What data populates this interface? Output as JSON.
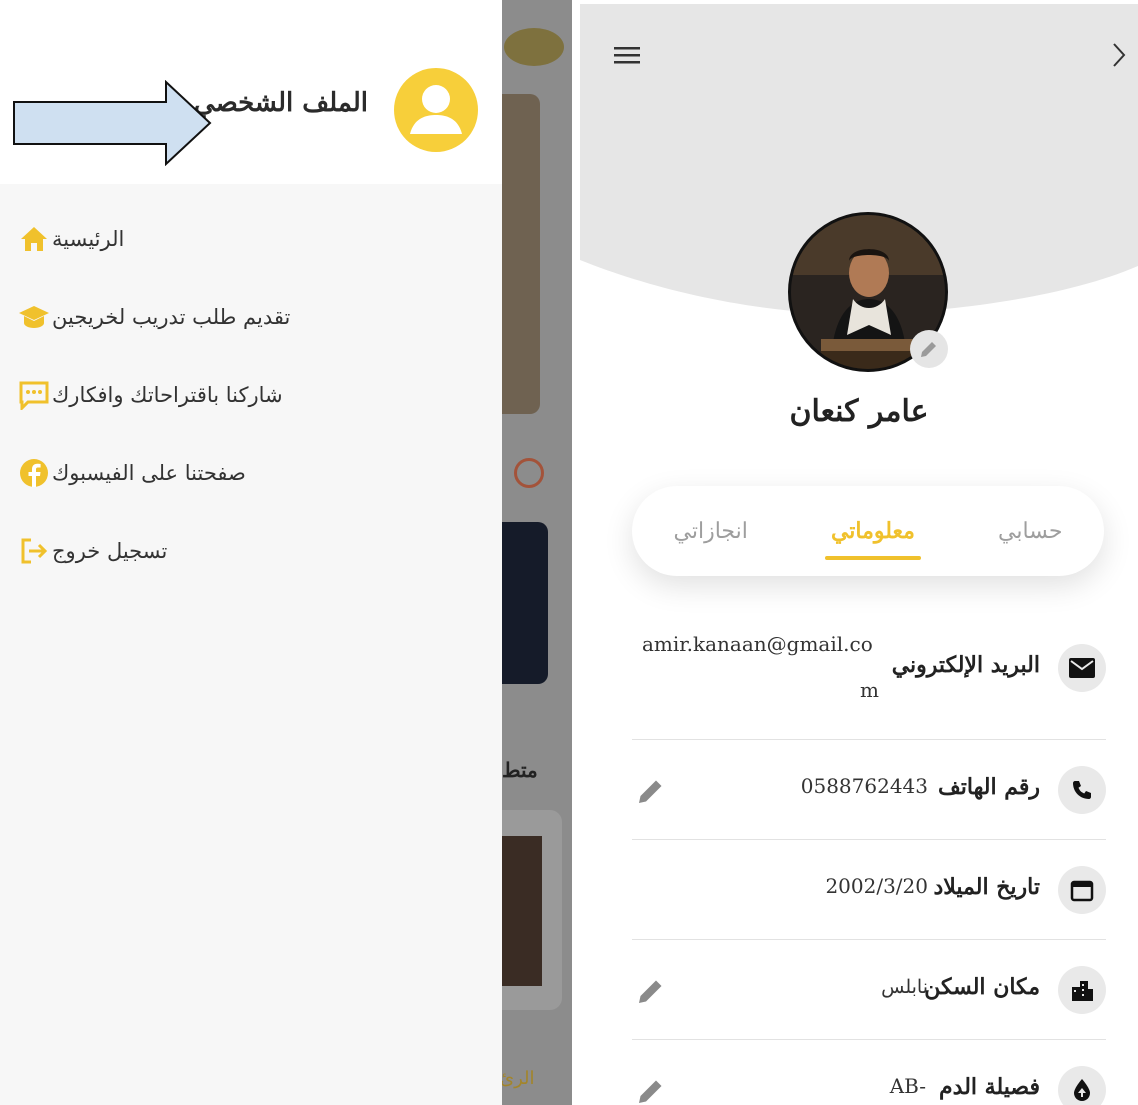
{
  "drawer": {
    "title": "الملف الشخصي",
    "items": [
      {
        "label": "الرئيسية",
        "icon": "home-icon"
      },
      {
        "label": "تقديم طلب تدريب لخريجين",
        "icon": "graduation-cap-icon"
      },
      {
        "label": "شاركنا باقتراحاتك وافكارك",
        "icon": "comment-icon"
      },
      {
        "label": "صفحتنا على الفيسبوك",
        "icon": "facebook-icon"
      },
      {
        "label": "تسجيل خروج",
        "icon": "logout-icon"
      }
    ]
  },
  "background_app": {
    "partial_text_1": "متط",
    "partial_text_2": "الرئ"
  },
  "profile": {
    "name": "عامر كنعان",
    "tabs": [
      {
        "label": "حسابي",
        "active": false
      },
      {
        "label": "معلوماتي",
        "active": true
      },
      {
        "label": "انجازاتي",
        "active": false
      }
    ],
    "info": [
      {
        "label": "البريد الإلكتروني",
        "value_line1": "amir.kanaan@gmail.co",
        "value_line2": "m",
        "icon": "email-icon",
        "editable": false
      },
      {
        "label": "رقم الهاتف",
        "value": "0588762443",
        "icon": "phone-icon",
        "editable": true
      },
      {
        "label": "تاريخ الميلاد",
        "value": "2002/3/20",
        "icon": "calendar-icon",
        "editable": false
      },
      {
        "label": "مكان السكن",
        "value": "نابلس",
        "icon": "city-icon",
        "editable": true
      },
      {
        "label": "فصيلة الدم",
        "value": "AB-",
        "icon": "blood-drop-icon",
        "editable": true
      }
    ]
  },
  "colors": {
    "accent": "#f0c12c",
    "drawer_bg": "#f7f7f7",
    "header_grey": "#e6e6e6",
    "text_dark": "#222222"
  }
}
